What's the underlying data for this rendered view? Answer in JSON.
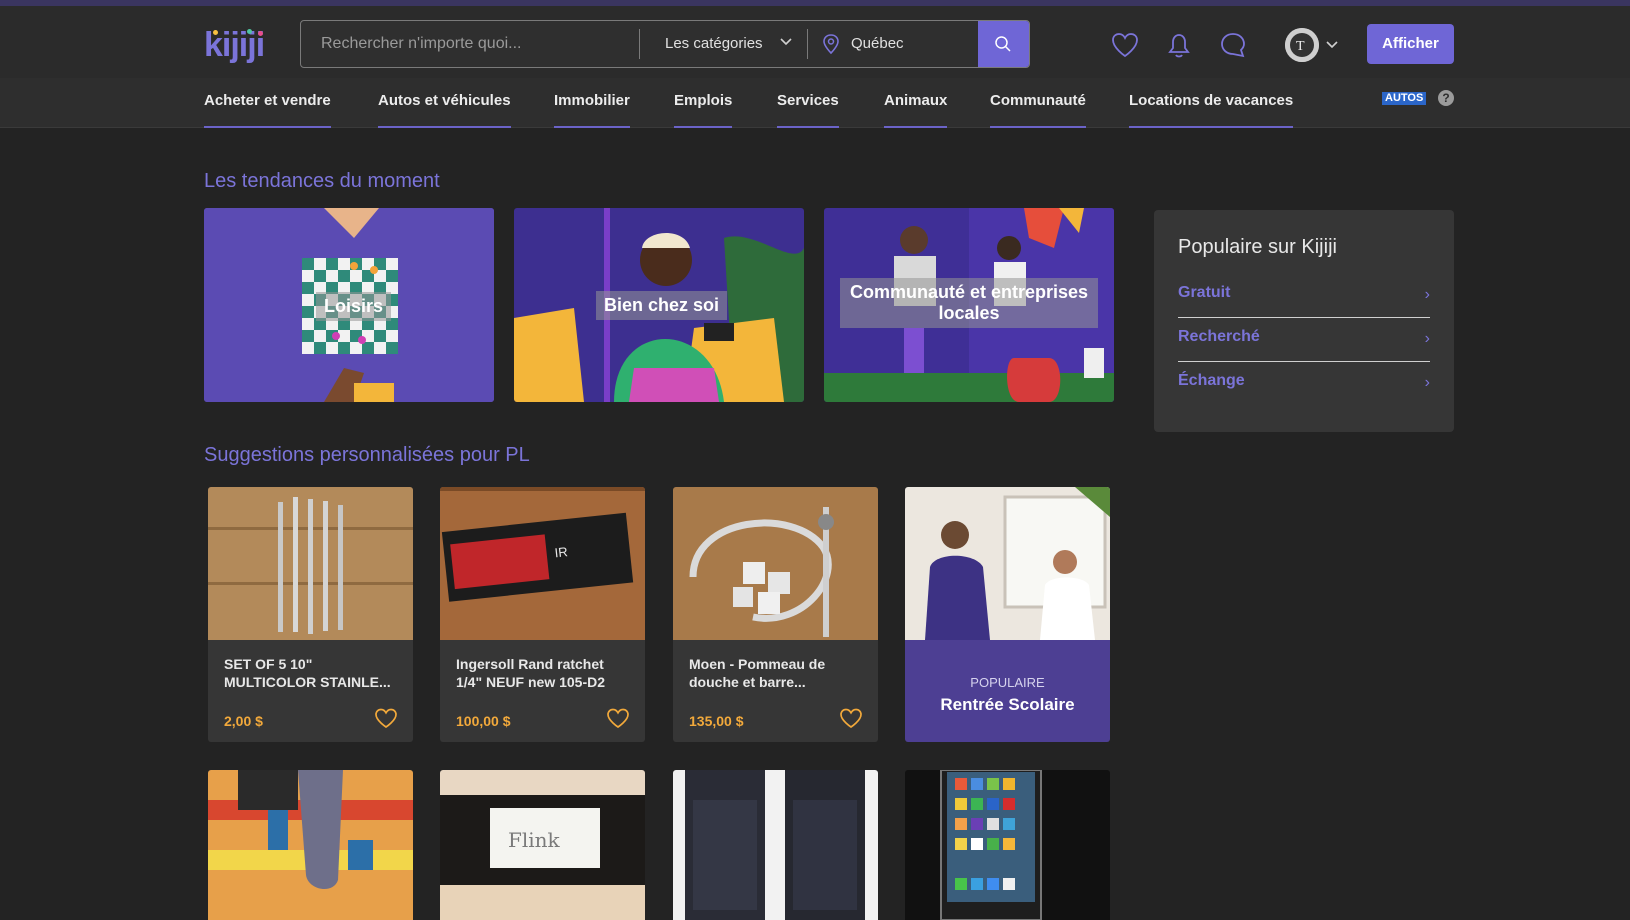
{
  "header": {
    "logo": "kijiji",
    "search_placeholder": "Rechercher n'importe quoi...",
    "category": "Les catégories",
    "location": "Québec",
    "post_button": "Afficher"
  },
  "nav": {
    "items": [
      "Acheter et vendre",
      "Autos et véhicules",
      "Immobilier",
      "Emplois",
      "Services",
      "Animaux",
      "Communauté",
      "Locations de vacances"
    ],
    "autos_badge": "AUTOS",
    "help": "?"
  },
  "trends": {
    "title": "Les tendances du moment",
    "items": [
      "Loisirs",
      "Bien chez soi",
      "Communauté et entreprises locales"
    ]
  },
  "popular": {
    "title": "Populaire sur Kijiji",
    "links": [
      "Gratuit",
      "Recherché",
      "Échange"
    ]
  },
  "suggestions": {
    "title": "Suggestions personnalisées pour PL",
    "cards": [
      {
        "title": "SET OF 5 10\" MULTICOLOR STAINLE...",
        "price": "2,00 $"
      },
      {
        "title": "Ingersoll Rand ratchet 1/4\" NEUF new 105-D2",
        "price": "100,00 $"
      },
      {
        "title": "Moen - Pommeau de douche et barre...",
        "price": "135,00 $"
      }
    ],
    "promo": {
      "tag": "POPULAIRE",
      "name": "Rentrée Scolaire"
    },
    "row2_labels": [
      "Flink"
    ]
  },
  "colors": {
    "accent": "#6f66d6",
    "price": "#f2a93b",
    "bg": "#232323"
  }
}
